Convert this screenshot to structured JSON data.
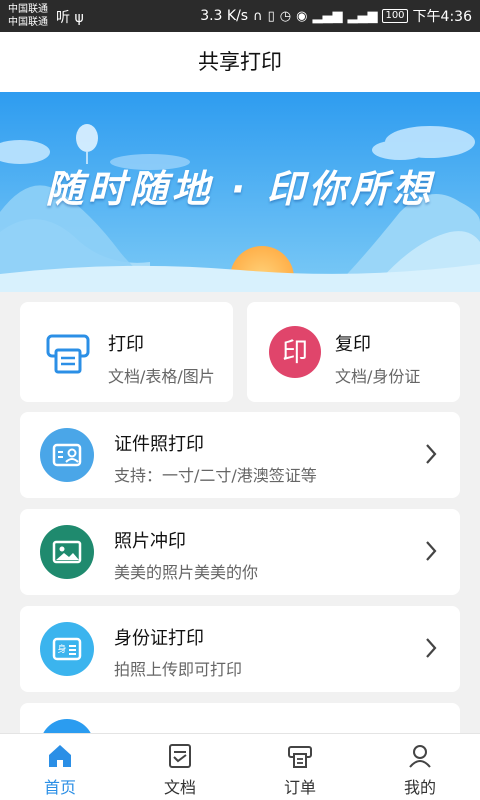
{
  "status_bar": {
    "carrier_1": "中国联通",
    "carrier_2": "中国联通",
    "speed": "3.3 K/s",
    "battery": "100",
    "time": "下午4:36"
  },
  "header": {
    "title": "共享打印"
  },
  "banner": {
    "slogan": "随时随地 · 印你所想"
  },
  "quick_actions": [
    {
      "title": "打印",
      "subtitle": "文档/表格/图片",
      "icon": "printer-icon",
      "color": "#2b8fe6"
    },
    {
      "title": "复印",
      "subtitle": "文档/身份证",
      "icon": "copy-stamp-icon",
      "color": "#e0456b"
    }
  ],
  "services": [
    {
      "title": "证件照打印",
      "subtitle": "支持：一寸/二寸/港澳签证等",
      "icon": "id-photo-icon",
      "color": "#4aa6e8"
    },
    {
      "title": "照片冲印",
      "subtitle": "美美的照片美美的你",
      "icon": "photo-icon",
      "color": "#1f8a6e"
    },
    {
      "title": "身份证打印",
      "subtitle": "拍照上传即可打印",
      "icon": "id-card-icon",
      "color": "#3bb4ee"
    },
    {
      "title": "",
      "subtitle": "",
      "icon": "more-icon",
      "color": "#2b9cf0"
    }
  ],
  "tab_bar": {
    "active": "首页",
    "items": [
      {
        "label": "首页",
        "icon": "home-icon"
      },
      {
        "label": "文档",
        "icon": "document-icon"
      },
      {
        "label": "订单",
        "icon": "order-icon"
      },
      {
        "label": "我的",
        "icon": "profile-icon"
      }
    ]
  }
}
